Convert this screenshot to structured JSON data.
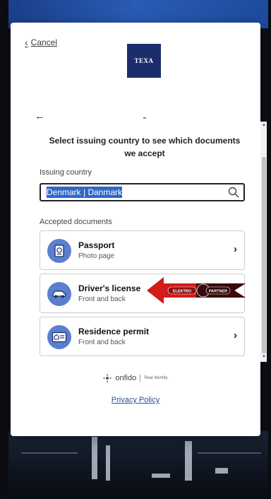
{
  "nav": {
    "cancel_label": "Cancel",
    "back_icon": "arrow-left-icon"
  },
  "brand": {
    "logo_text": "TEXA",
    "logo_color": "#1b2d6b"
  },
  "heading": "Select issuing country to see which documents we accept",
  "country": {
    "label": "Issuing country",
    "value": "Denmark | Danmark",
    "selection_color": "#2f66c9"
  },
  "documents": {
    "label": "Accepted documents",
    "items": [
      {
        "title": "Passport",
        "subtitle": "Photo page",
        "icon": "passport-icon"
      },
      {
        "title": "Driver's license",
        "subtitle": "Front and back",
        "icon": "car-icon"
      },
      {
        "title": "Residence permit",
        "subtitle": "Front and back",
        "icon": "id-card-icon"
      }
    ]
  },
  "overlay_ad": {
    "text_left": "ELEKTRO",
    "text_right": "PARTNER",
    "arrow_color": "#d41a1a"
  },
  "footer": {
    "brand": "onfido",
    "tagline": "Real Identity",
    "privacy_label": "Privacy Policy"
  },
  "accent_color": "#5b7fcc"
}
